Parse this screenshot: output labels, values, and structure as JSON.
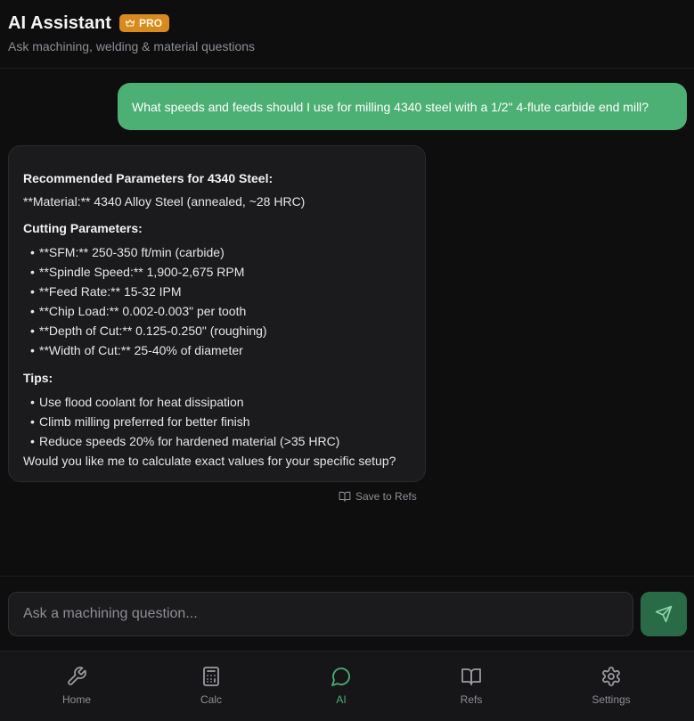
{
  "header": {
    "title": "AI Assistant",
    "badge": "PRO",
    "subtitle": "Ask machining, welding & material questions"
  },
  "messages": {
    "user": "What speeds and feeds should I use for milling 4340 steel with a 1/2\" 4-flute carbide end mill?",
    "assistant": {
      "heading": "Recommended Parameters for 4340 Steel:",
      "material_line": "**Material:** 4340 Alloy Steel (annealed, ~28 HRC)",
      "cutting_heading": "Cutting Parameters:",
      "cutting_items": [
        "**SFM:** 250-350 ft/min (carbide)",
        "**Spindle Speed:** 1,900-2,675 RPM",
        "**Feed Rate:** 15-32 IPM",
        "**Chip Load:** 0.002-0.003\" per tooth",
        "**Depth of Cut:** 0.125-0.250\" (roughing)",
        "**Width of Cut:** 25-40% of diameter"
      ],
      "tips_heading": "Tips:",
      "tips_items": [
        "Use flood coolant for heat dissipation",
        "Climb milling preferred for better finish",
        "Reduce speeds 20% for hardened material (>35 HRC)"
      ],
      "closing": "Would you like me to calculate exact values for your specific setup?"
    },
    "save_label": "Save to Refs"
  },
  "input": {
    "placeholder": "Ask a machining question...",
    "value": ""
  },
  "nav": {
    "items": [
      {
        "label": "Home",
        "icon": "wrench-icon"
      },
      {
        "label": "Calc",
        "icon": "calculator-icon"
      },
      {
        "label": "AI",
        "icon": "chat-bubble-icon",
        "active": true
      },
      {
        "label": "Refs",
        "icon": "book-icon"
      },
      {
        "label": "Settings",
        "icon": "gear-icon"
      }
    ]
  },
  "colors": {
    "background": "#0e0e0f",
    "accent": "#4caf74",
    "badge": "#d98a1c",
    "send_button": "#2a6b47",
    "muted_text": "#8e8e94"
  }
}
